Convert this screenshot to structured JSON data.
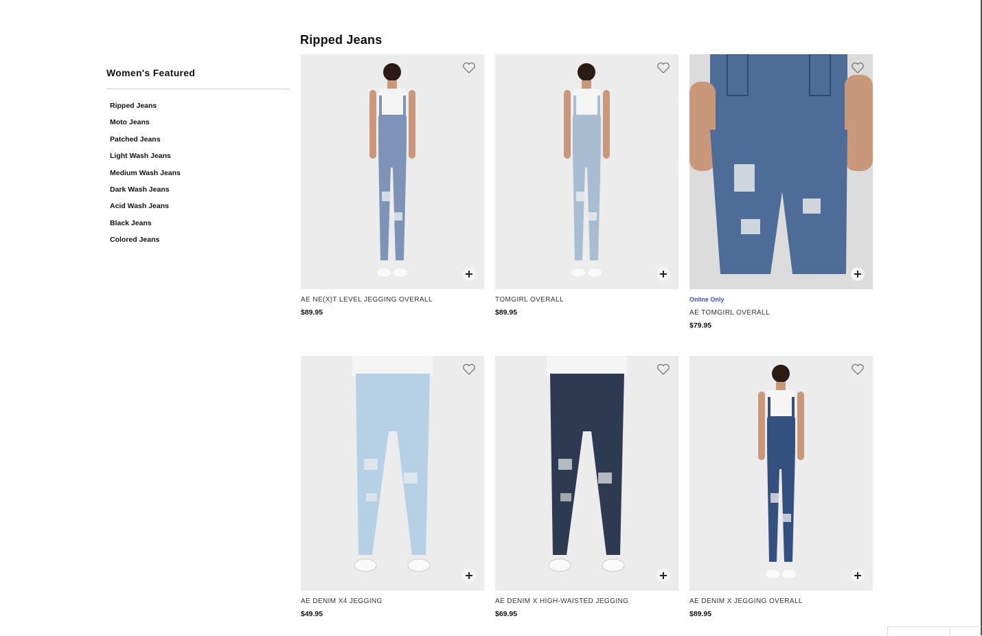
{
  "page": {
    "title": "Ripped Jeans"
  },
  "sidebar": {
    "title": "Women's Featured",
    "items": [
      {
        "label": "Ripped Jeans"
      },
      {
        "label": "Moto Jeans"
      },
      {
        "label": "Patched Jeans"
      },
      {
        "label": "Light Wash Jeans"
      },
      {
        "label": "Medium Wash Jeans"
      },
      {
        "label": "Dark Wash Jeans"
      },
      {
        "label": "Acid Wash Jeans"
      },
      {
        "label": "Black Jeans"
      },
      {
        "label": "Colored Jeans"
      }
    ]
  },
  "products": [
    {
      "name": "AE NE(X)T LEVEL JEGGING OVERALL",
      "price": "$89.95",
      "badge": "",
      "wash": "#7d93b8",
      "style": "overall-full"
    },
    {
      "name": "TOMGIRL OVERALL",
      "price": "$89.95",
      "badge": "",
      "wash": "#a8bdd2",
      "style": "overall-full"
    },
    {
      "name": "AE TOMGIRL OVERALL",
      "price": "$79.95",
      "badge": "Online Only",
      "wash": "#4d6d98",
      "style": "overall-crop"
    },
    {
      "name": "AE DENIM X4 JEGGING",
      "price": "$49.95",
      "badge": "",
      "wash": "#b6d0e6",
      "style": "jegging"
    },
    {
      "name": "AE DENIM X HIGH-WAISTED JEGGING",
      "price": "$69.95",
      "badge": "",
      "wash": "#2e3a52",
      "style": "jegging"
    },
    {
      "name": "AE DENIM X JEGGING OVERALL",
      "price": "$89.95",
      "badge": "",
      "wash": "#34507f",
      "style": "overall-full"
    }
  ],
  "colors": {
    "online_badge": "#3355cc",
    "photo_background": "#ececec"
  },
  "icons": {
    "favorite": "heart-icon",
    "quick_add": "plus-icon"
  }
}
